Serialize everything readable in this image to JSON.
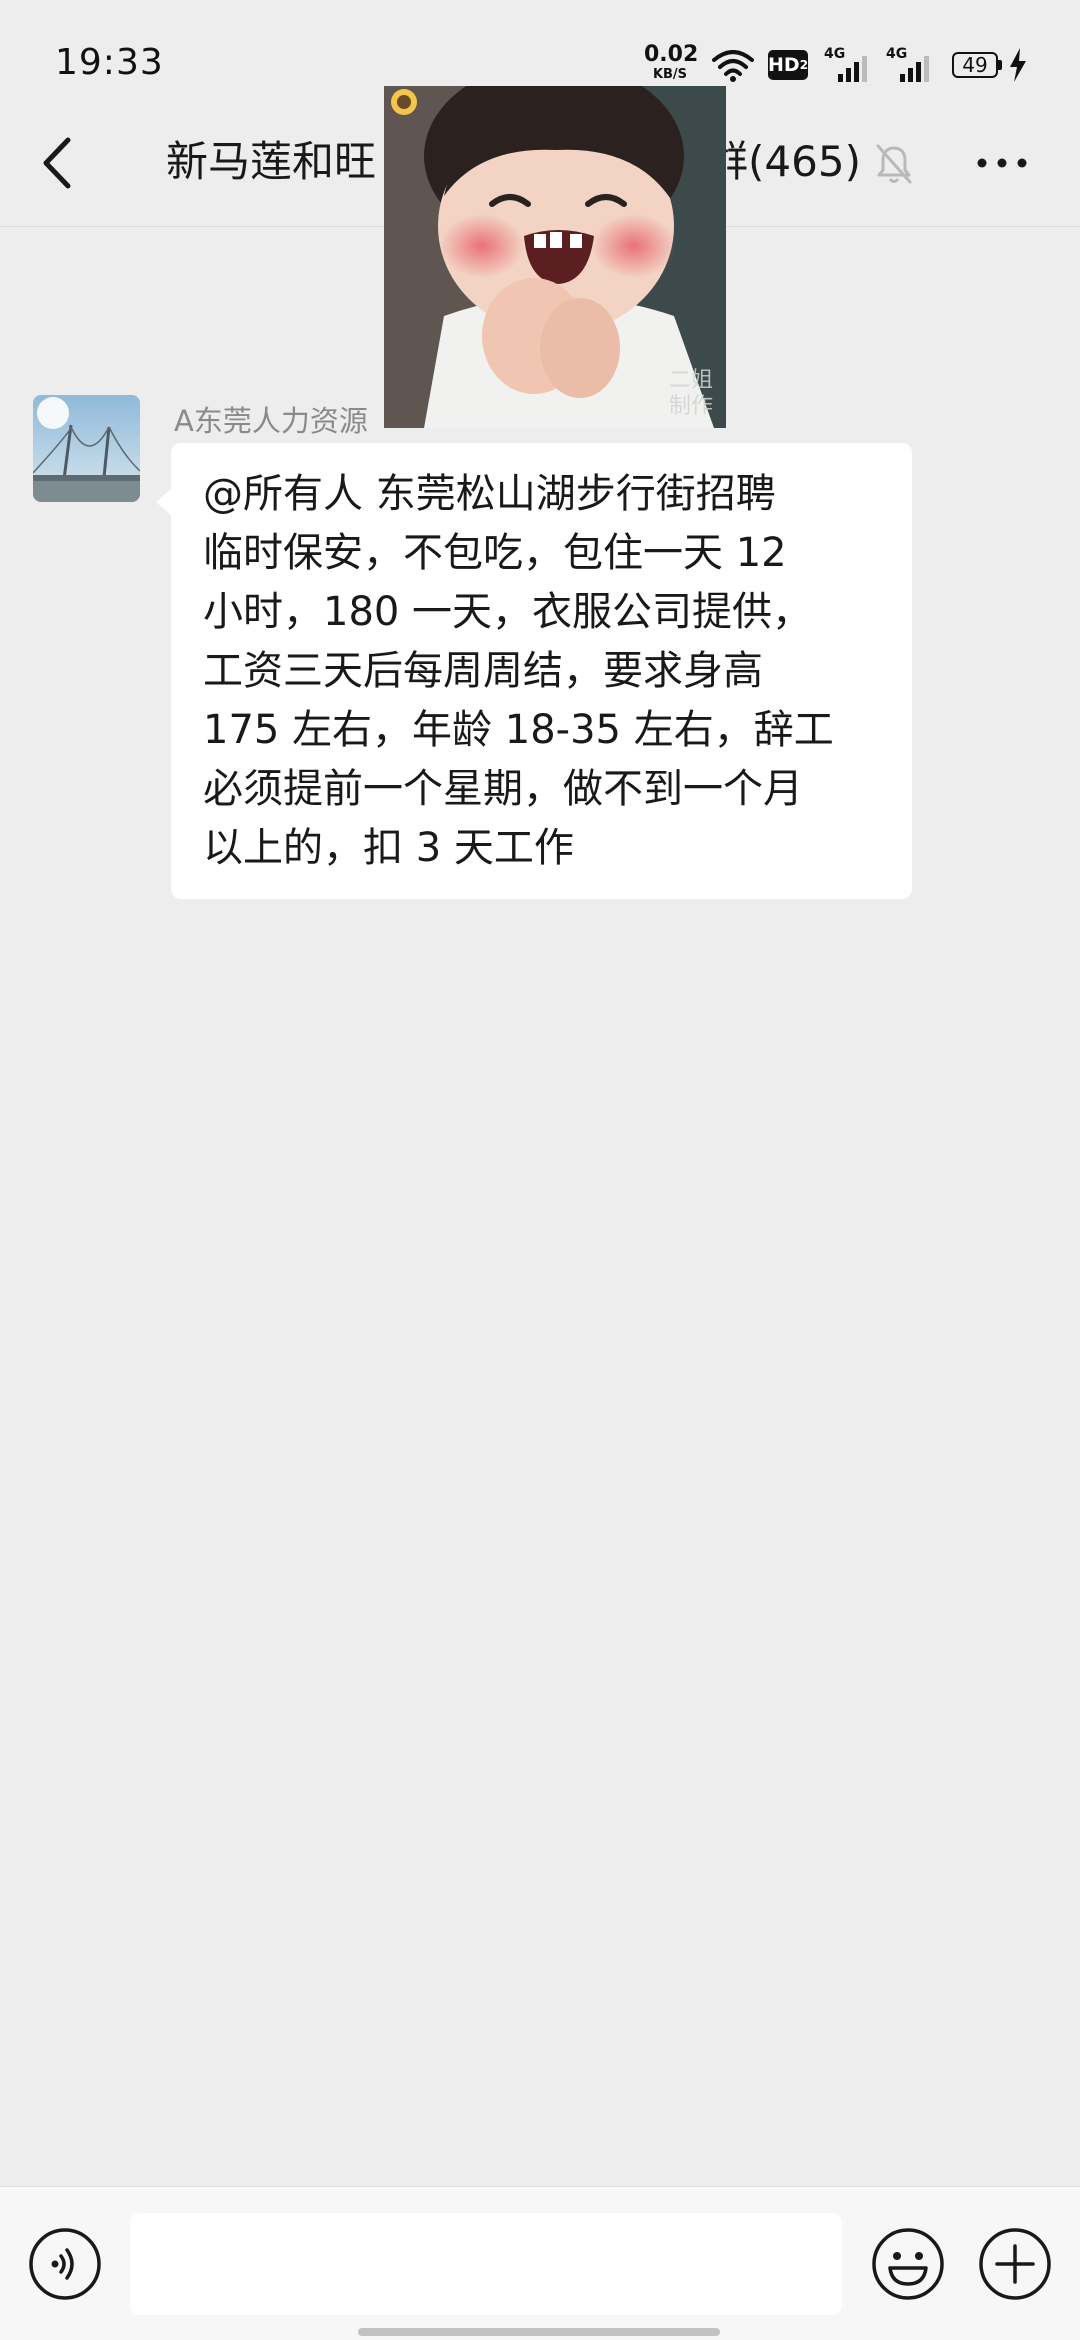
{
  "status_bar": {
    "time": "19:33",
    "net_speed_value": "0.02",
    "net_speed_unit": "KB/S",
    "hd_label": "HD",
    "hd_sub": "2",
    "signal_1_label": "4G",
    "signal_2_label": "4G",
    "battery_level": "49"
  },
  "header": {
    "title": "新马莲和旺",
    "title_suffix": "群(465)",
    "icons": [
      "back-icon",
      "mute-bell-icon",
      "more-icon"
    ]
  },
  "sticker": {
    "caption": "二姐制作"
  },
  "message": {
    "sender": "A东莞人力资源",
    "text": "@所有人  东莞松山湖步行街招聘\n临时保安，不包吃，包住一天 12\n小时，180 一天，衣服公司提供，\n工资三天后每周周结，要求身高\n175 左右，年龄 18-35 左右，辞工\n必须提前一个星期，做不到一个月\n以上的，扣 3 天工作"
  },
  "input_bar": {
    "value": "",
    "icons": [
      "voice-icon",
      "emoji-icon",
      "plus-icon"
    ]
  },
  "colors": {
    "background": "#ededed",
    "bubble": "#ffffff",
    "input_bar": "#f7f7f7",
    "sender_text": "#8a8a8a",
    "primary_text": "#191919"
  }
}
